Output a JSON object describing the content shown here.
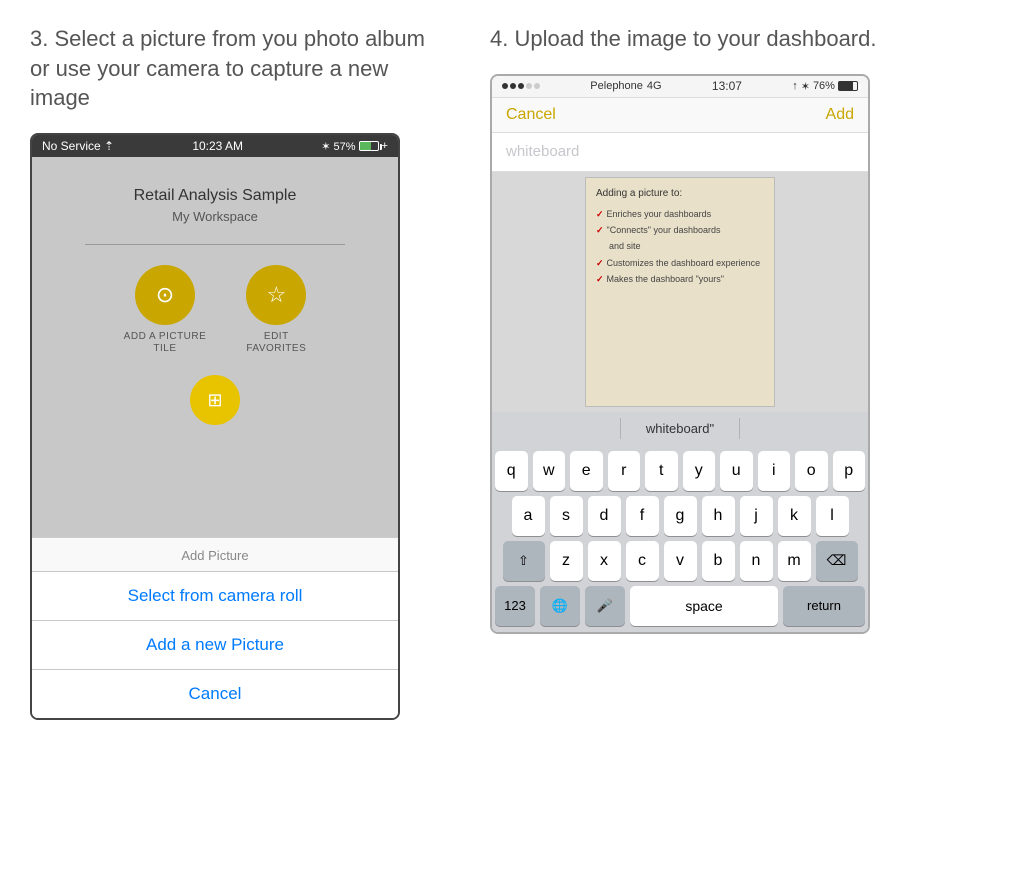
{
  "left": {
    "step_title": "3. Select a picture from you photo album or use your camera to capture a new image",
    "phone": {
      "status": {
        "left": "No Service ⇡",
        "center": "10:23 AM",
        "right_signal": "* 57%"
      },
      "report_title": "Retail Analysis Sample",
      "report_subtitle": "My Workspace",
      "btn1_label": "ADD A PICTURE\nTILE",
      "btn2_label": "EDIT\nFAVORITES",
      "action_sheet": {
        "title": "Add Picture",
        "option1": "Select from camera roll",
        "option2": "Add a new Picture",
        "cancel": "Cancel"
      }
    }
  },
  "right": {
    "step_title": "4. Upload the image to your dashboard.",
    "phone": {
      "status": {
        "carrier": "Pelephone",
        "network": "4G",
        "time": "13:07",
        "battery": "76%"
      },
      "nav": {
        "cancel": "Cancel",
        "add": "Add"
      },
      "input_placeholder": "whiteboard",
      "autocomplete": "whiteboard\"",
      "keyboard_rows": [
        [
          "q",
          "w",
          "e",
          "r",
          "t",
          "y",
          "u",
          "i",
          "o",
          "p"
        ],
        [
          "a",
          "s",
          "d",
          "f",
          "g",
          "h",
          "j",
          "k",
          "l"
        ],
        [
          "z",
          "x",
          "c",
          "v",
          "b",
          "n",
          "m"
        ]
      ],
      "key_space": "space",
      "key_return": "return",
      "key_123": "123"
    }
  },
  "icons": {
    "camera": "⊙",
    "star": "☆",
    "shift": "⇧",
    "delete": "⌫",
    "globe": "🌐",
    "mic": "🎤"
  }
}
